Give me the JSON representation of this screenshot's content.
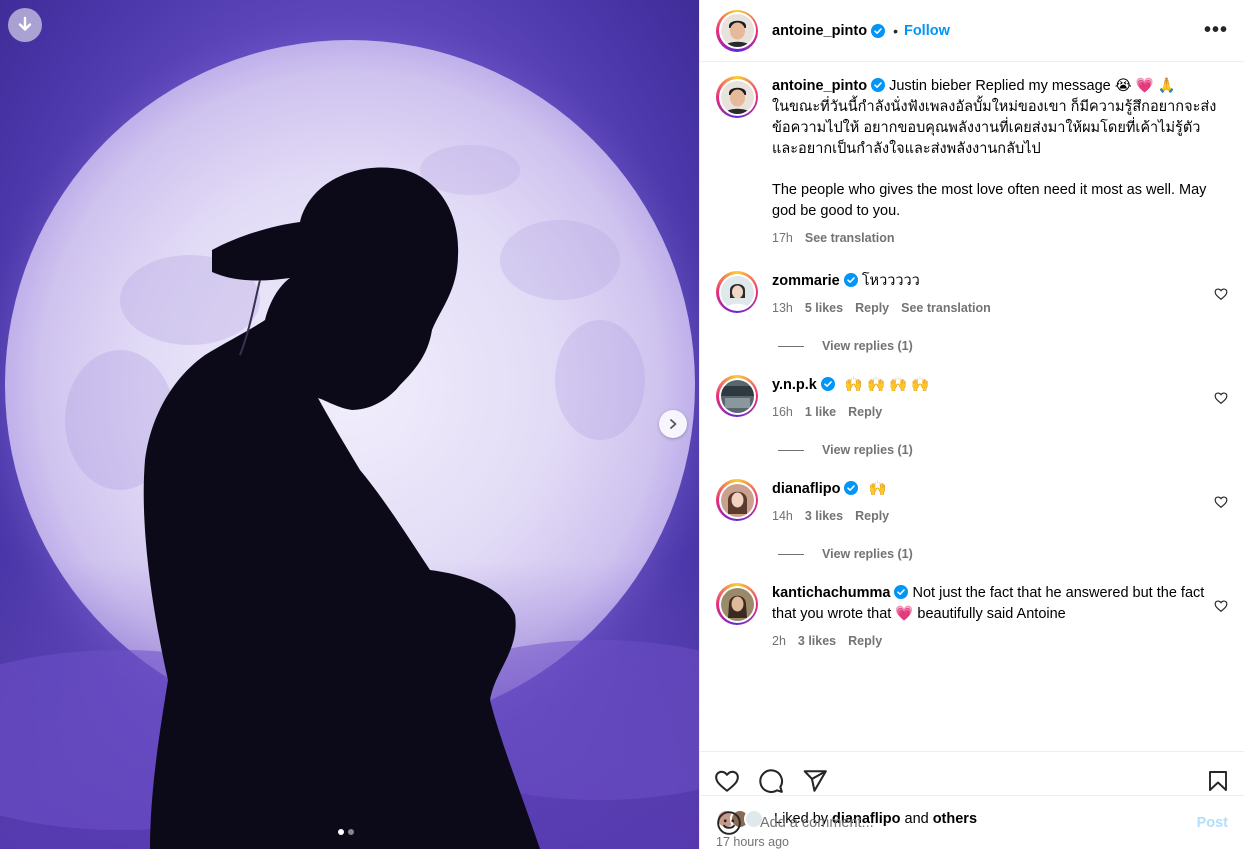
{
  "media": {
    "download_icon": "download-arrow-icon",
    "next_icon": "chevron-right-icon",
    "slide_count": 2,
    "active_slide": 1
  },
  "post": {
    "author": "antoine_pinto",
    "follow_label": "Follow",
    "bullet": "•",
    "more_label": "•••",
    "caption": {
      "text_line1": "Justin bieber Replied my message 😭 💗 🙏",
      "text_thai": "ในขณะที่วันนี้กำลังนั่งฟังเพลงอัลบั้มใหม่ของเขา ก็มีความรู้สึกอยากจะส่งข้อความไปให้ อยากขอบคุณพลังงานที่เคยส่งมาให้ผมโดยที่เค้าไม่รู้ตัว และอยากเป็นกำลังใจและส่งพลังงานกลับไป",
      "text_en": "The people who gives the most love often need it most as well. May god be good to you.",
      "time": "17h",
      "see_translation": "See translation"
    }
  },
  "comments": [
    {
      "user": "zommarie",
      "text": "โหววววว",
      "time": "13h",
      "likes": "5 likes",
      "reply": "Reply",
      "see_translation": "See translation",
      "view_replies": "View replies (1)",
      "avatar_color": "#d9e6ea"
    },
    {
      "user": "y.n.p.k",
      "text": "🙌 🙌 🙌 🙌",
      "time": "16h",
      "likes": "1 like",
      "reply": "Reply",
      "view_replies": "View replies (1)",
      "avatar_color": "#5d6b73"
    },
    {
      "user": "dianaflipo",
      "text": "🙌",
      "time": "14h",
      "likes": "3 likes",
      "reply": "Reply",
      "view_replies": "View replies (1)",
      "avatar_color": "#c89a8a"
    },
    {
      "user": "kantichachumma",
      "text": "Not just the fact that he answered but the fact that you wrote that 💗 beautifully said Antoine",
      "time": "2h",
      "likes": "3 likes",
      "reply": "Reply",
      "avatar_color": "#8a6a55"
    }
  ],
  "likes": {
    "prefix": "Liked by",
    "user": "dianaflipo",
    "and": "and",
    "others": "others",
    "time_ago": "17 hours ago"
  },
  "add_comment": {
    "placeholder": "Add a comment...",
    "post_label": "Post"
  },
  "colors": {
    "link_blue": "#0095f6",
    "muted": "#737373",
    "post_disabled": "#b2dffc",
    "verified": "#0095f6"
  }
}
